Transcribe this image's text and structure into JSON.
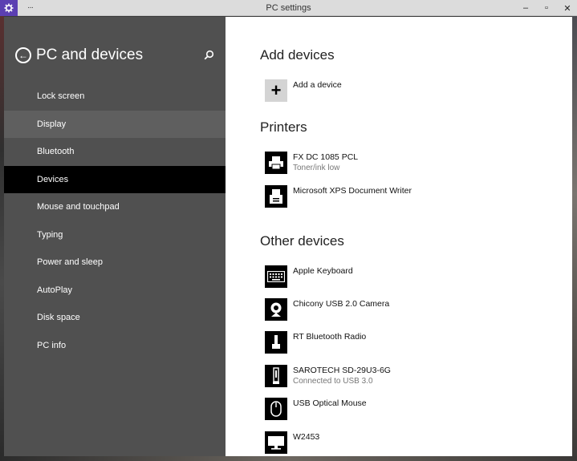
{
  "window": {
    "title": "PC settings",
    "app_icon": "gear-icon",
    "menu_dots": "···",
    "minimize": "–",
    "maximize": "▫",
    "close": "✕"
  },
  "sidebar": {
    "title": "PC and devices",
    "back_icon": "back-arrow-icon",
    "search_icon": "search-icon",
    "items": [
      {
        "label": "Lock screen"
      },
      {
        "label": "Display"
      },
      {
        "label": "Bluetooth"
      },
      {
        "label": "Devices"
      },
      {
        "label": "Mouse and touchpad"
      },
      {
        "label": "Typing"
      },
      {
        "label": "Power and sleep"
      },
      {
        "label": "AutoPlay"
      },
      {
        "label": "Disk space"
      },
      {
        "label": "PC info"
      }
    ],
    "active_item": "Devices",
    "hover_item": "Display"
  },
  "main": {
    "add_devices": {
      "title": "Add devices",
      "add_label": "Add a device"
    },
    "printers": {
      "title": "Printers",
      "items": [
        {
          "name": "FX DC 1085 PCL",
          "status": "Toner/ink low",
          "icon": "printer-icon"
        },
        {
          "name": "Microsoft XPS Document Writer",
          "status": "",
          "icon": "document-printer-icon"
        }
      ]
    },
    "other_devices": {
      "title": "Other devices",
      "items": [
        {
          "name": "Apple Keyboard",
          "status": "",
          "icon": "keyboard-icon"
        },
        {
          "name": "Chicony USB 2.0 Camera",
          "status": "",
          "icon": "webcam-icon"
        },
        {
          "name": "RT Bluetooth Radio",
          "status": "",
          "icon": "usb-device-icon"
        },
        {
          "name": "SAROTECH SD-29U3-6G",
          "status": "Connected to USB 3.0",
          "icon": "usb-drive-icon"
        },
        {
          "name": "USB Optical Mouse",
          "status": "",
          "icon": "mouse-icon"
        },
        {
          "name": "W2453",
          "status": "",
          "icon": "monitor-icon"
        }
      ]
    }
  }
}
